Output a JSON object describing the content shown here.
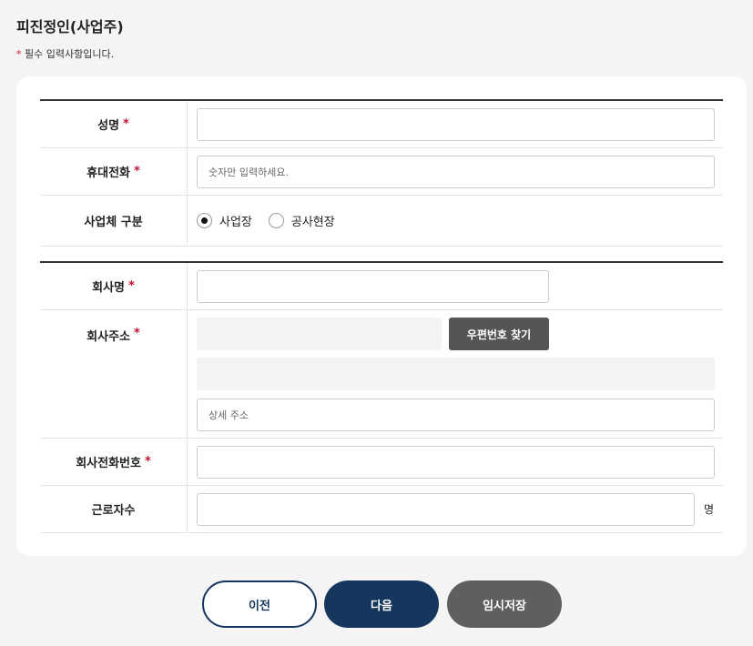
{
  "page": {
    "title": "피진정인(사업주)",
    "required_star": "*",
    "required_note": " 필수 입력사항입니다."
  },
  "person": {
    "name_label": "성명",
    "phone_label": "휴대전화",
    "phone_placeholder": "숫자만 입력하세요.",
    "biz_type_label": "사업체 구분",
    "biz_type_options": [
      "사업장",
      "공사현장"
    ],
    "biz_type_selected": "사업장"
  },
  "company": {
    "name_label": "회사명",
    "address_label": "회사주소",
    "zip_button": "우편번호 찾기",
    "detail_address_placeholder": "상세 주소",
    "phone_label": "회사전화번호",
    "workers_label": "근로자수",
    "workers_unit": "명"
  },
  "actions": {
    "prev": "이전",
    "next": "다음",
    "temp_save": "임시저장"
  },
  "colors": {
    "navy": "#15375d",
    "required": "#c8102e",
    "gray_button": "#5f5f5f"
  }
}
